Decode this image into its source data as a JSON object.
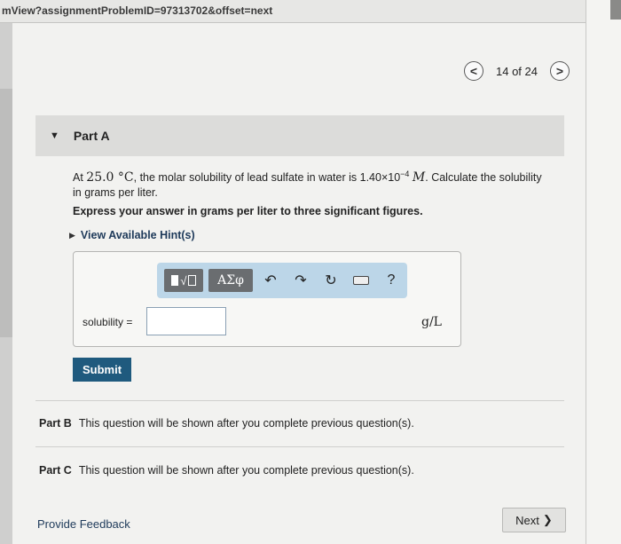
{
  "url": "mView?assignmentProblemID=97313702&offset=next",
  "pager": {
    "prev_glyph": "<",
    "count": "14 of 24",
    "next_glyph": ">"
  },
  "part_a": {
    "label": "Part A",
    "question_pre": "At",
    "temperature": "25.0 °C",
    "question_mid": ", the molar solubility of lead sulfate in water is 1.40×10",
    "exponent": "−4",
    "molarity_unit": "M",
    "question_post": ". Calculate the solubility in grams per liter.",
    "instruction": "Express your answer in grams per liter to three significant figures.",
    "hints_label": "View Available Hint(s)"
  },
  "toolbar": {
    "templates_root": "√",
    "greek_label": "ΑΣφ",
    "undo_glyph": "↶",
    "redo_glyph": "↷",
    "reset_glyph": "↻",
    "help_glyph": "?"
  },
  "answer": {
    "label": "solubility =",
    "value": "",
    "unit": "g/L"
  },
  "submit_label": "Submit",
  "part_b": {
    "label": "Part B",
    "text": "This question will be shown after you complete previous question(s)."
  },
  "part_c": {
    "label": "Part C",
    "text": "This question will be shown after you complete previous question(s)."
  },
  "feedback_label": "Provide Feedback",
  "next_label": "Next",
  "next_glyph": "❯"
}
